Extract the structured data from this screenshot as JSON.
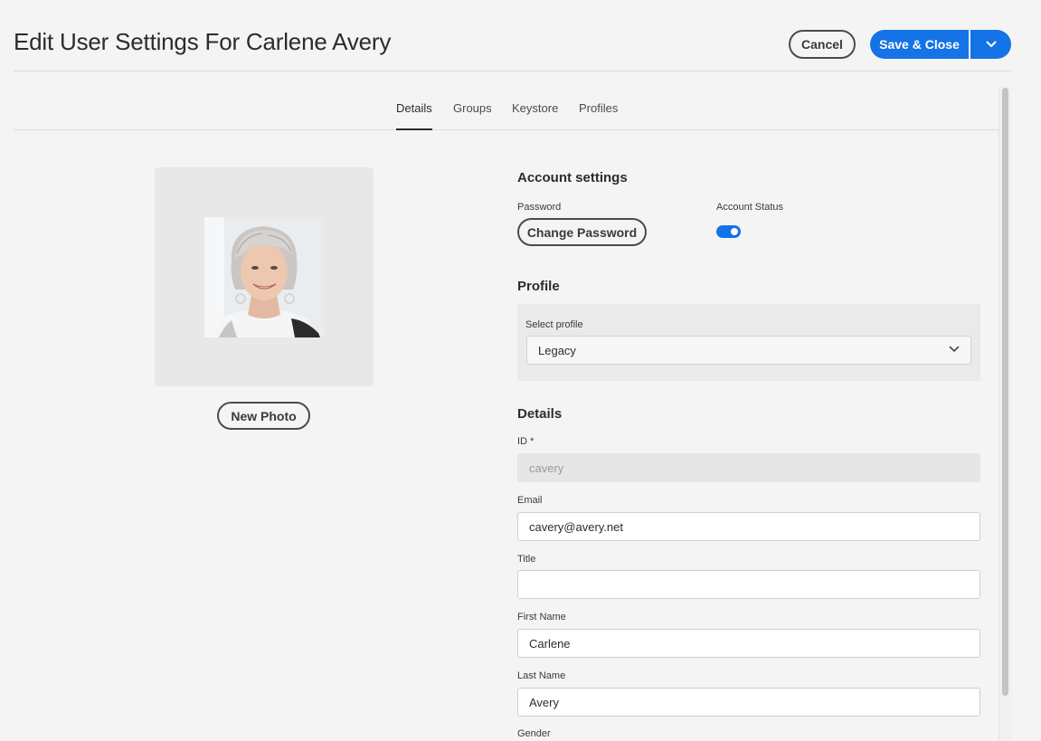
{
  "header": {
    "title": "Edit User Settings For Carlene Avery",
    "cancel_label": "Cancel",
    "save_label": "Save & Close"
  },
  "tabs": [
    {
      "label": "Details",
      "active": true
    },
    {
      "label": "Groups",
      "active": false
    },
    {
      "label": "Keystore",
      "active": false
    },
    {
      "label": "Profiles",
      "active": false
    }
  ],
  "photo": {
    "new_photo_label": "New Photo"
  },
  "account": {
    "heading": "Account settings",
    "password_label": "Password",
    "change_password_label": "Change Password",
    "status_label": "Account Status",
    "status_enabled": true
  },
  "profile": {
    "heading": "Profile",
    "select_label": "Select profile",
    "selected": "Legacy"
  },
  "details": {
    "heading": "Details",
    "id_label": "ID *",
    "id_value": "cavery",
    "email_label": "Email",
    "email_value": "cavery@avery.net",
    "title_label": "Title",
    "title_value": "",
    "first_name_label": "First Name",
    "first_name_value": "Carlene",
    "last_name_label": "Last Name",
    "last_name_value": "Avery",
    "gender_label": "Gender"
  },
  "colors": {
    "accent": "#1473e6",
    "background": "#f4f4f4"
  }
}
